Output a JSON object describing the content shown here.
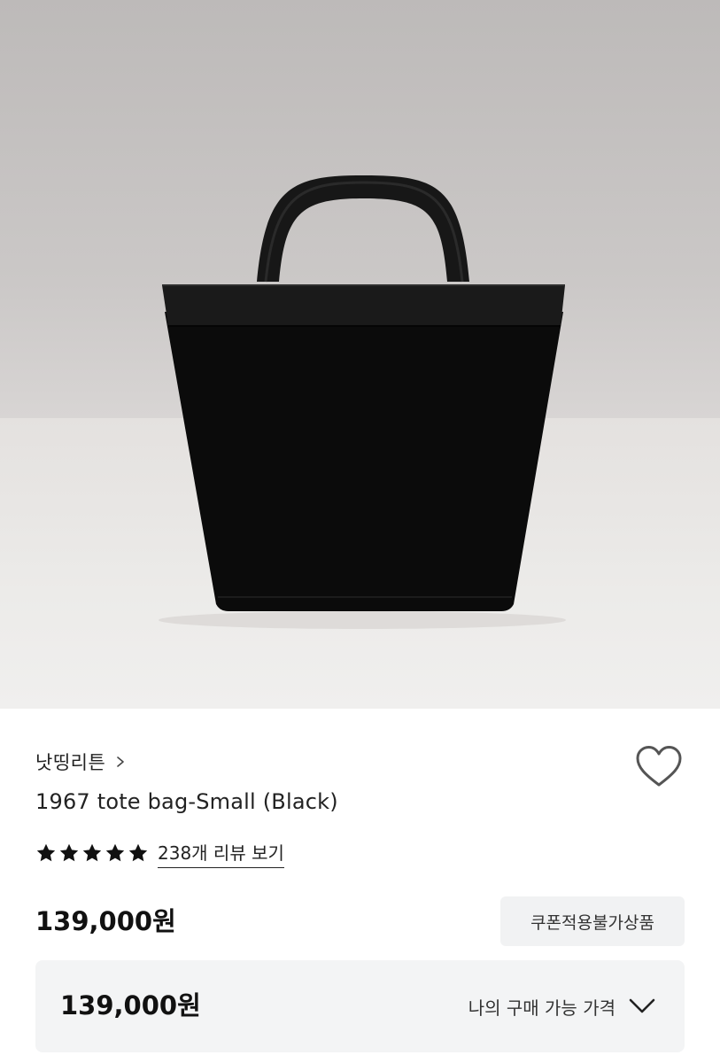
{
  "product": {
    "brand_name": "낫띵리튼",
    "title": "1967 tote bag-Small (Black)",
    "rating_stars": 5,
    "review_link": "238개 리뷰 보기",
    "price": "139,000원",
    "coupon_badge": "쿠폰적용불가상품"
  },
  "my_price": {
    "value": "139,000원",
    "label": "나의 구매 가능 가격"
  },
  "icons": {
    "brand_chevron": "chevron-right-icon",
    "wishlist": "heart-outline-icon",
    "star": "star-filled-icon",
    "expand": "chevron-down-icon"
  },
  "colors": {
    "text_primary": "#111111",
    "panel_bg": "#f3f4f5",
    "bag": "#0b0b0b"
  }
}
